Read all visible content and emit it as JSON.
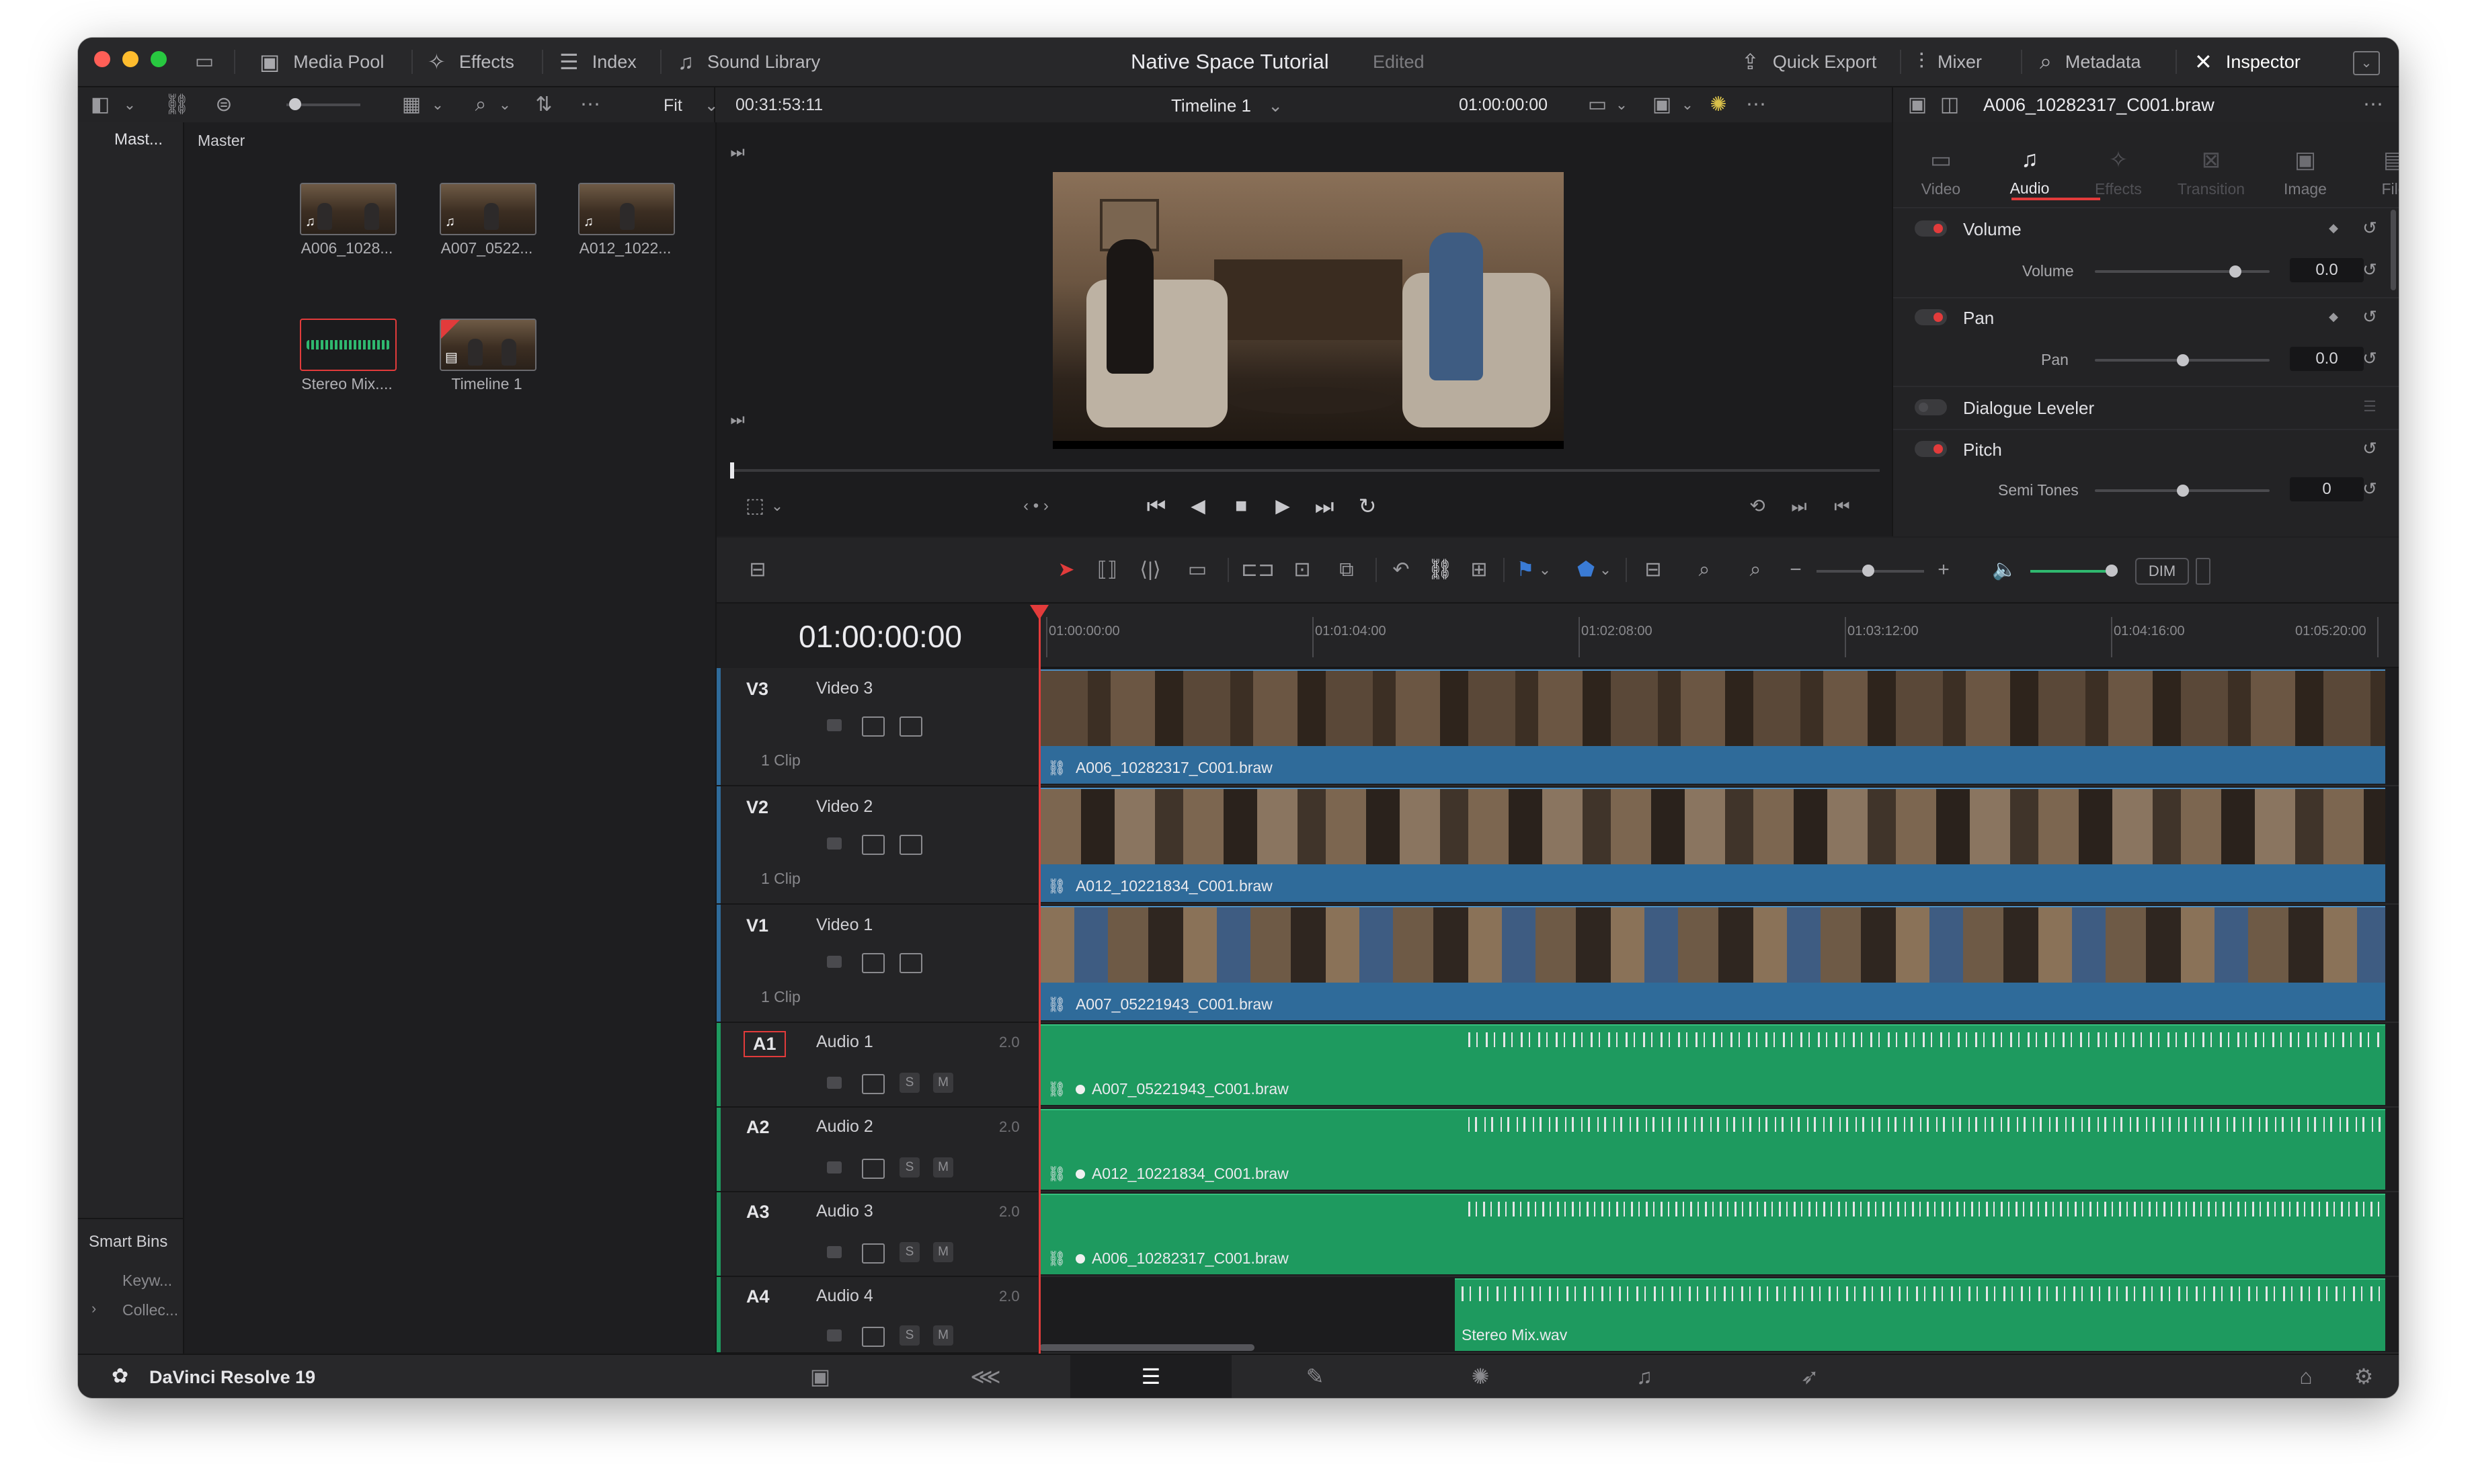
{
  "header": {
    "media_pool": "Media Pool",
    "effects": "Effects",
    "index": "Index",
    "sound_library": "Sound Library",
    "project_title": "Native Space Tutorial",
    "project_status": "Edited",
    "quick_export": "Quick Export",
    "mixer": "Mixer",
    "metadata": "Metadata",
    "inspector": "Inspector"
  },
  "subbar": {
    "fit": "Fit",
    "source_timecode": "00:31:53:11",
    "timeline_name": "Timeline 1",
    "record_timecode": "01:00:00:00",
    "clip_name": "A006_10282317_C001.braw"
  },
  "bins": {
    "master_short": "Mast...",
    "smart_bins": "Smart Bins",
    "keywords": "Keyw...",
    "collections": "Collec..."
  },
  "pool": {
    "header": "Master",
    "items": [
      {
        "label": "A006_1028...",
        "icon": "music-icon"
      },
      {
        "label": "A007_0522...",
        "icon": "music-icon"
      },
      {
        "label": "A012_1022...",
        "icon": "music-icon"
      },
      {
        "label": "Stereo Mix....",
        "icon": "waveform-icon"
      },
      {
        "label": "Timeline 1",
        "icon": "timeline-icon"
      }
    ]
  },
  "inspector": {
    "tabs": [
      "Video",
      "Audio",
      "Effects",
      "Transition",
      "Image",
      "File"
    ],
    "active_tab": "Audio",
    "volume_header": "Volume",
    "volume_label": "Volume",
    "volume_value": "0.0",
    "pan_header": "Pan",
    "pan_label": "Pan",
    "pan_value": "0.0",
    "dialogue_leveler": "Dialogue Leveler",
    "pitch_header": "Pitch",
    "semitones_label": "Semi Tones",
    "semitones_value": "0"
  },
  "timeline": {
    "timecode": "01:00:00:00",
    "dim": "DIM",
    "ruler": [
      "01:00:00:00",
      "01:01:04:00",
      "01:02:08:00",
      "01:03:12:00",
      "01:04:16:00",
      "01:05:20:00"
    ],
    "video_tracks": [
      {
        "id": "V3",
        "name": "Video 3",
        "info": "1 Clip",
        "clip": "A006_10282317_C001.braw"
      },
      {
        "id": "V2",
        "name": "Video 2",
        "info": "1 Clip",
        "clip": "A012_10221834_C001.braw"
      },
      {
        "id": "V1",
        "name": "Video 1",
        "info": "1 Clip",
        "clip": "A007_05221943_C001.braw"
      }
    ],
    "audio_tracks": [
      {
        "id": "A1",
        "name": "Audio 1",
        "channels": "2.0",
        "clip": "A007_05221943_C001.braw"
      },
      {
        "id": "A2",
        "name": "Audio 2",
        "channels": "2.0",
        "clip": "A012_10221834_C001.braw"
      },
      {
        "id": "A3",
        "name": "Audio 3",
        "channels": "2.0",
        "clip": "A006_10282317_C001.braw"
      },
      {
        "id": "A4",
        "name": "Audio 4",
        "channels": "2.0",
        "clip": "Stereo Mix.wav"
      }
    ],
    "solo": "S",
    "mute": "M"
  },
  "footer": {
    "app_name": "DaVinci Resolve 19"
  },
  "colors": {
    "video_clip": "#2f6b9a",
    "audio_clip": "#1e9a5f",
    "playhead": "#e33b3b",
    "accent_red": "#e23b3b"
  }
}
